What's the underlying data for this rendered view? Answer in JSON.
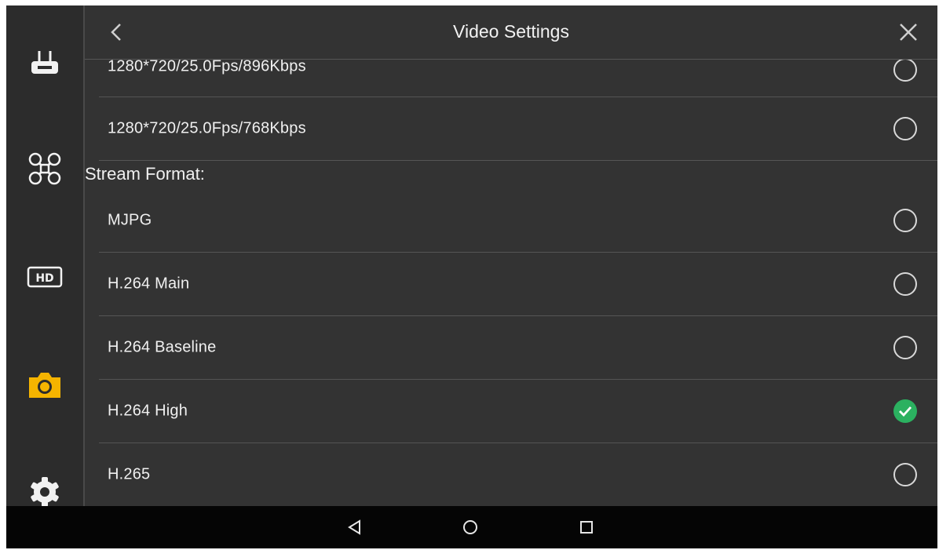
{
  "header": {
    "title": "Video Settings",
    "back_icon": "chevron-left-icon",
    "close_icon": "close-icon"
  },
  "sidebar": {
    "items": [
      {
        "name": "remote-controller",
        "icon": "remote-controller-icon",
        "active": false
      },
      {
        "name": "aircraft",
        "icon": "drone-icon",
        "active": false
      },
      {
        "name": "hd-video",
        "icon": "hd-icon",
        "active": false
      },
      {
        "name": "camera",
        "icon": "camera-icon",
        "active": true
      },
      {
        "name": "settings",
        "icon": "gear-icon",
        "active": false
      }
    ],
    "active_color": "#f5b400"
  },
  "resolutions": [
    {
      "label": "1280*720/25.0Fps/896Kbps",
      "selected": false
    },
    {
      "label": "1280*720/25.0Fps/768Kbps",
      "selected": false
    }
  ],
  "stream_format": {
    "label": "Stream Format:",
    "options": [
      {
        "label": "MJPG",
        "selected": false
      },
      {
        "label": "H.264 Main",
        "selected": false
      },
      {
        "label": "H.264 Baseline",
        "selected": false
      },
      {
        "label": "H.264 High",
        "selected": true
      },
      {
        "label": "H.265",
        "selected": false
      }
    ]
  },
  "colors": {
    "check_green": "#2bb160",
    "background": "#333333"
  },
  "navbar": {
    "back_icon": "triangle-back-icon",
    "home_icon": "circle-home-icon",
    "recents_icon": "square-recents-icon"
  }
}
